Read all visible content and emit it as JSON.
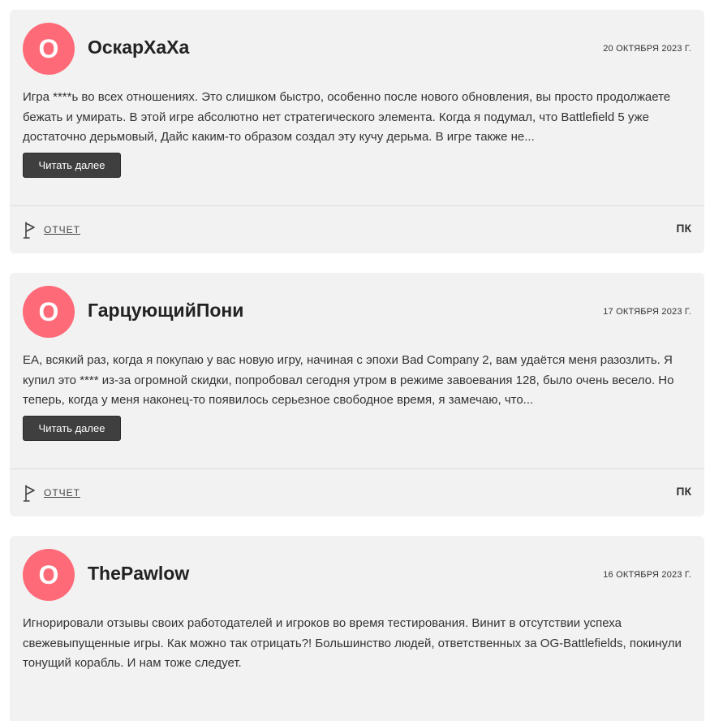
{
  "reviews": [
    {
      "avatar_letter": "O",
      "username": "ОскарХаХа",
      "date": "20 ОКТЯБРЯ 2023 Г.",
      "text": "Игра ****ь во всех отношениях. Это слишком быстро, особенно после нового обновления, вы просто продолжаете бежать и умирать. В этой игре абсолютно нет стратегического элемента. Когда я подумал, что Battlefield 5 уже достаточно дерьмовый, Дайс каким-то образом создал эту кучу дерьма. В игре также не...",
      "read_more": "Читать далее",
      "report": "ОТЧЕТ",
      "platform": "ПК"
    },
    {
      "avatar_letter": "O",
      "username": "ГарцующийПони",
      "date": "17 ОКТЯБРЯ 2023 Г.",
      "text": "EA, всякий раз, когда я покупаю у вас новую игру, начиная с эпохи Bad Company 2, вам удаётся меня разозлить. Я купил это **** из-за огромной скидки, попробовал сегодня утром в режиме завоевания 128, было очень весело. Но теперь, когда у меня наконец-то появилось серьезное свободное время, я замечаю, что...",
      "read_more": "Читать далее",
      "report": "ОТЧЕТ",
      "platform": "ПК"
    },
    {
      "avatar_letter": "O",
      "username": "ThePawlow",
      "date": "16 ОКТЯБРЯ 2023 Г.",
      "text": "Игнорировали отзывы своих работодателей и игроков во время тестирования. Винит в отсутствии успеха свежевыпущенные игры. Как можно так отрицать?! Большинство людей, ответственных за OG-Battlefields, покинули тонущий корабль. И нам тоже следует."
    }
  ],
  "colors": {
    "avatar_bg": "#ff6a78",
    "card_bg": "#f2f2f2",
    "button_bg": "#3f3f3f"
  },
  "icons": {
    "report": "flag-icon"
  }
}
